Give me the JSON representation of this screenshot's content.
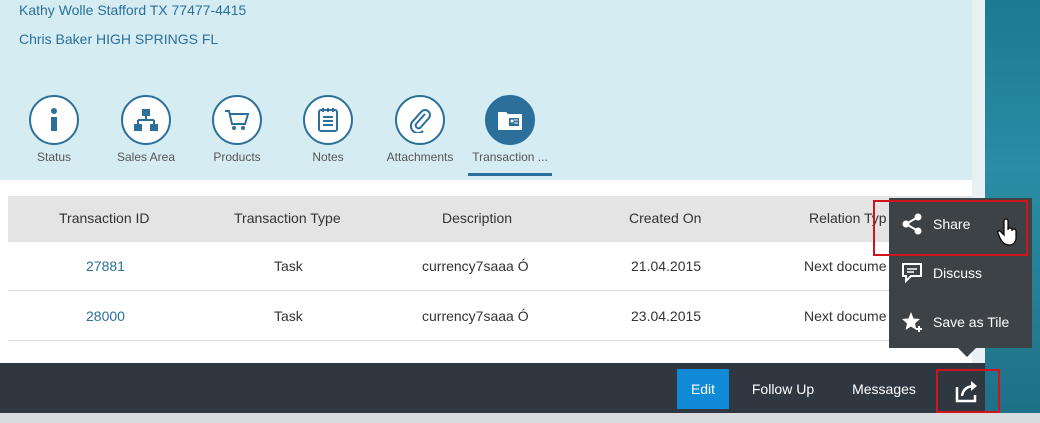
{
  "header": {
    "contacts": [
      "Kathy Wolle Stafford TX 77477-4415",
      "Chris Baker HIGH SPRINGS FL"
    ]
  },
  "tabs": [
    {
      "label": "Status",
      "icon": "info-icon"
    },
    {
      "label": "Sales Area",
      "icon": "org-chart-icon"
    },
    {
      "label": "Products",
      "icon": "cart-icon"
    },
    {
      "label": "Notes",
      "icon": "notes-icon"
    },
    {
      "label": "Attachments",
      "icon": "paperclip-icon"
    },
    {
      "label": "Transaction ...",
      "icon": "contact-card-icon"
    }
  ],
  "table": {
    "columns": [
      "Transaction ID",
      "Transaction Type",
      "Description",
      "Created On",
      "Relation Typ"
    ],
    "rows": [
      [
        "27881",
        "Task",
        "currency7saaa Ó",
        "21.04.2015",
        "Next docume"
      ],
      [
        "28000",
        "Task",
        "currency7saaa Ó",
        "23.04.2015",
        "Next docume"
      ]
    ]
  },
  "footer": {
    "edit": "Edit",
    "follow_up": "Follow Up",
    "messages": "Messages"
  },
  "popover": {
    "share": "Share",
    "discuss": "Discuss",
    "save_as_tile": "Save as Tile"
  },
  "colors": {
    "accent": "#2b6f9a",
    "edit_button": "#0e8ad6",
    "footer": "#2f3840",
    "highlight": "#d0141c"
  }
}
